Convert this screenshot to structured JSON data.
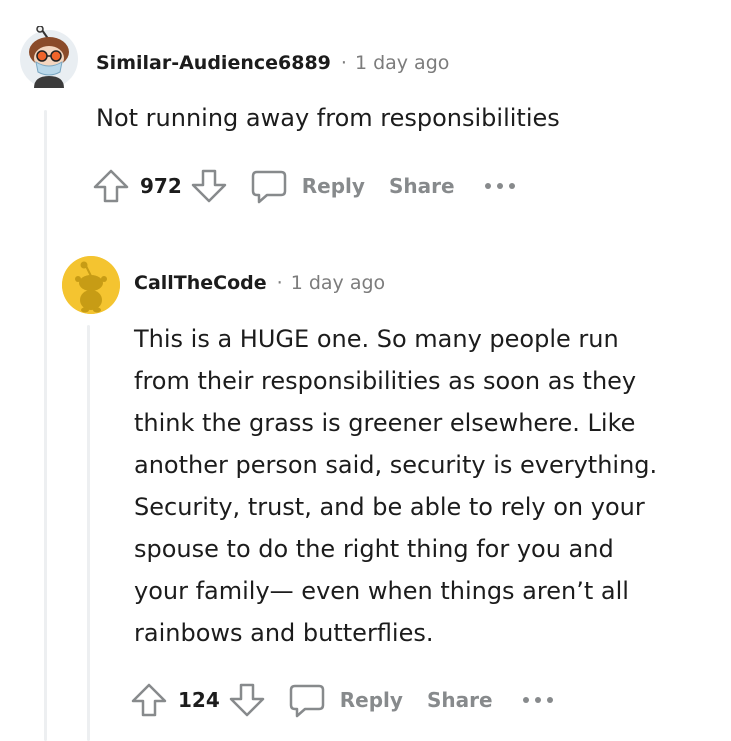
{
  "comments": [
    {
      "username": "Similar-Audience6889",
      "separator": "·",
      "timestamp": "1 day ago",
      "body": "Not running away from responsibilities",
      "votes": "972",
      "reply_label": "Reply",
      "share_label": "Share"
    },
    {
      "username": "CallTheCode",
      "separator": "·",
      "timestamp": "1 day ago",
      "body_lines": [
        "This is a HUGE one. So many people run",
        "from their responsibilities as soon as they",
        "think the grass is greener elsewhere. Like",
        "another person said, security is everything.",
        "Security, trust, and be able to rely on your",
        "spouse to do the right thing for you and",
        "your family— even when things aren’t all",
        "rainbows and butterflies."
      ],
      "votes": "124",
      "reply_label": "Reply",
      "share_label": "Share"
    }
  ],
  "icons": {
    "upvote": "upvote-arrow-icon",
    "downvote": "downvote-arrow-icon",
    "reply": "speech-bubble-icon",
    "more": "more-dots-icon"
  },
  "colors": {
    "action_gray": "#878a8c",
    "thread_line": "#edeff1",
    "avatar2_bg": "#f4c430"
  }
}
